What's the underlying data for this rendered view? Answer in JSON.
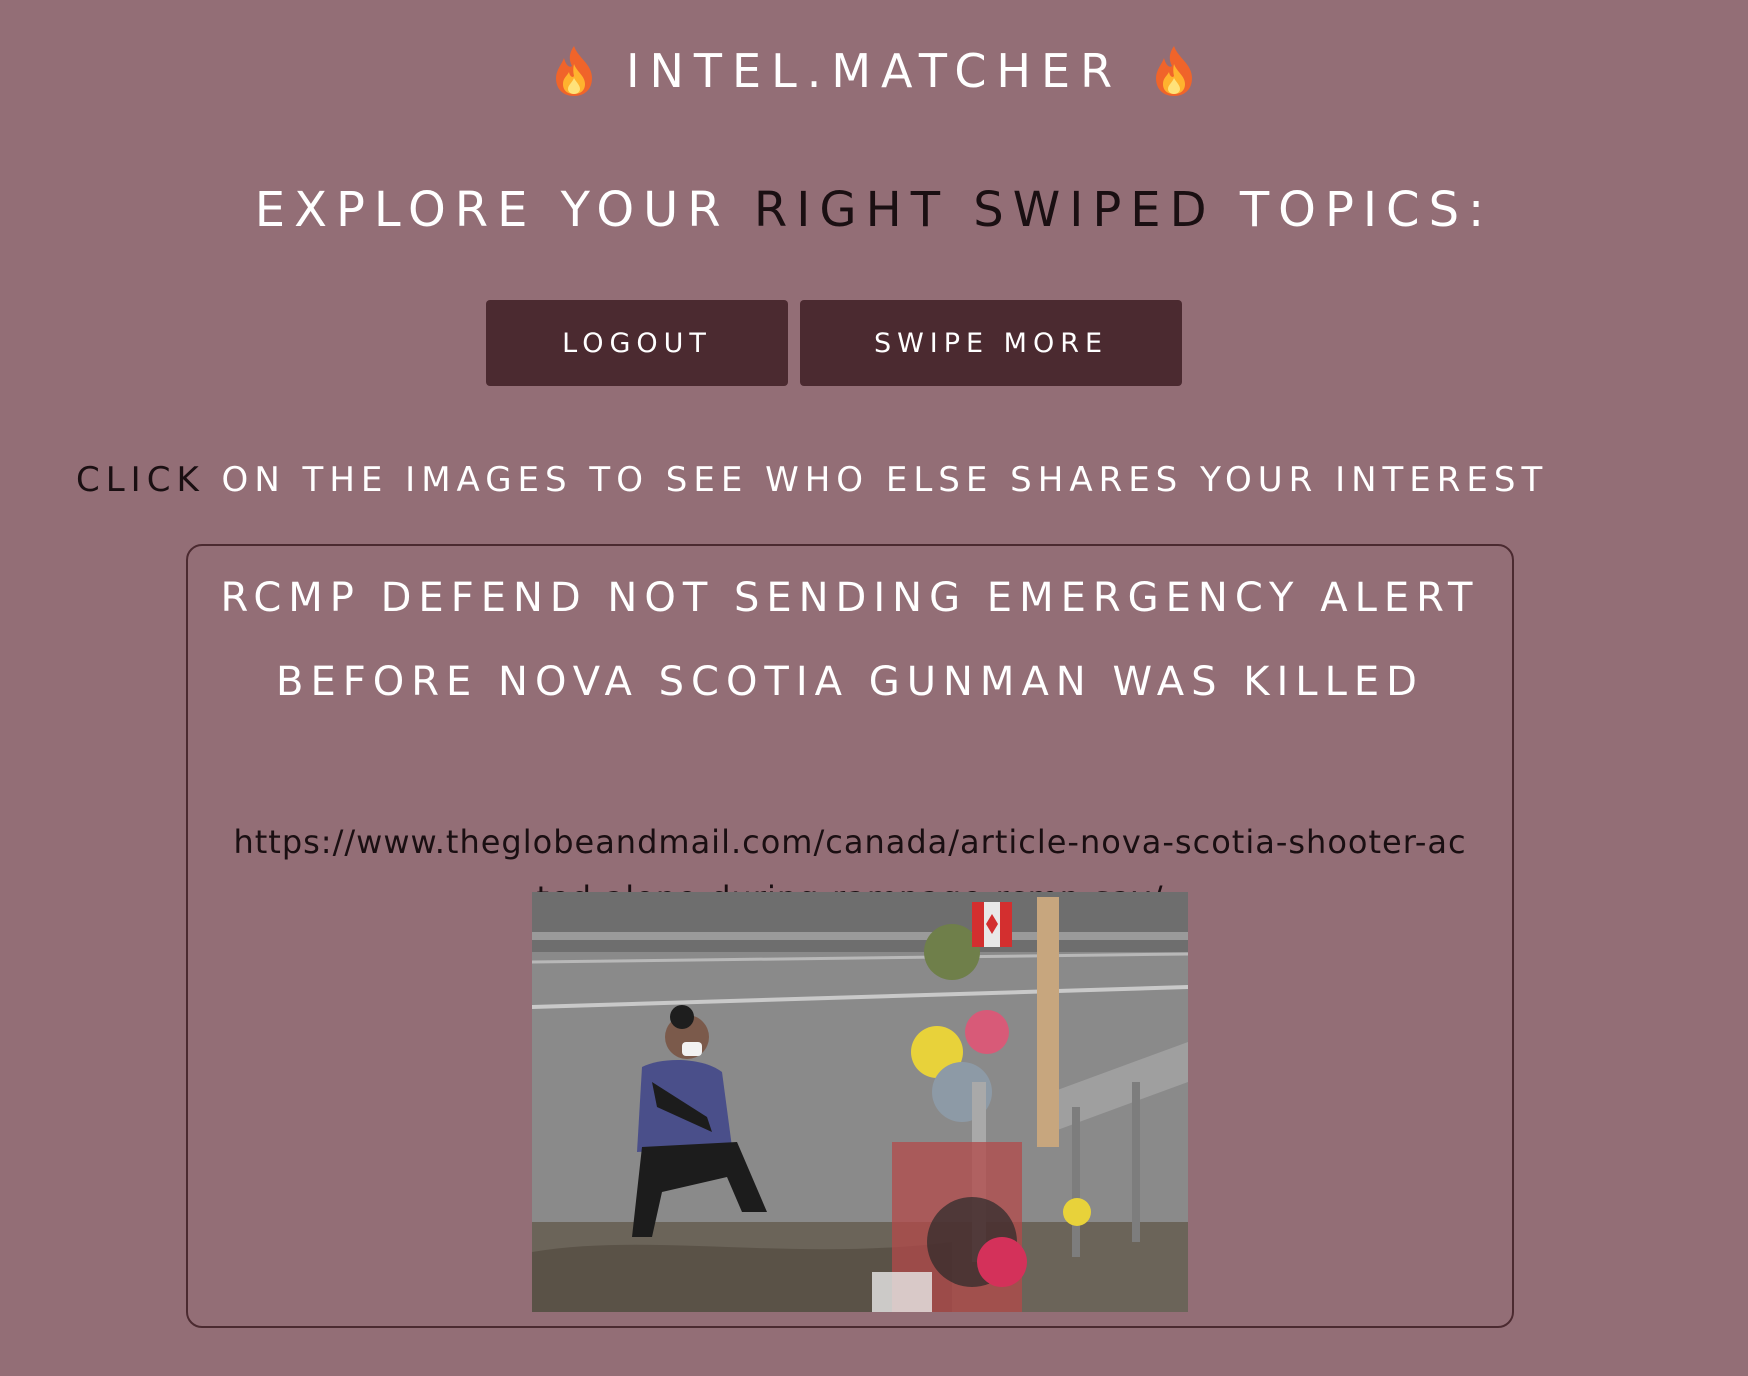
{
  "header": {
    "brand": "INTEL.MATCHER",
    "brand_icon": "fire-icon"
  },
  "page": {
    "title_part1": "EXPLORE YOUR ",
    "title_part2": "RIGHT SWIPED",
    "title_part3": " TOPICS:",
    "instruction_part1": "CLICK",
    "instruction_part2": " ON THE IMAGES TO SEE WHO ELSE SHARES YOUR INTEREST"
  },
  "actions": {
    "logout_label": "LOGOUT",
    "swipe_more_label": "SWIPE MORE"
  },
  "topic": {
    "title": "RCMP DEFEND NOT SENDING EMERGENCY ALERT BEFORE NOVA SCOTIA GUNMAN WAS KILLED",
    "url": "https://www.theglobeandmail.com/canada/article-nova-scotia-shooter-acted-alone-during-rampage-rcmp-say/"
  },
  "colors": {
    "background": "#936e76",
    "button": "#4b2a30",
    "dark_text": "#1a0f12",
    "light_text": "#ffffff"
  }
}
